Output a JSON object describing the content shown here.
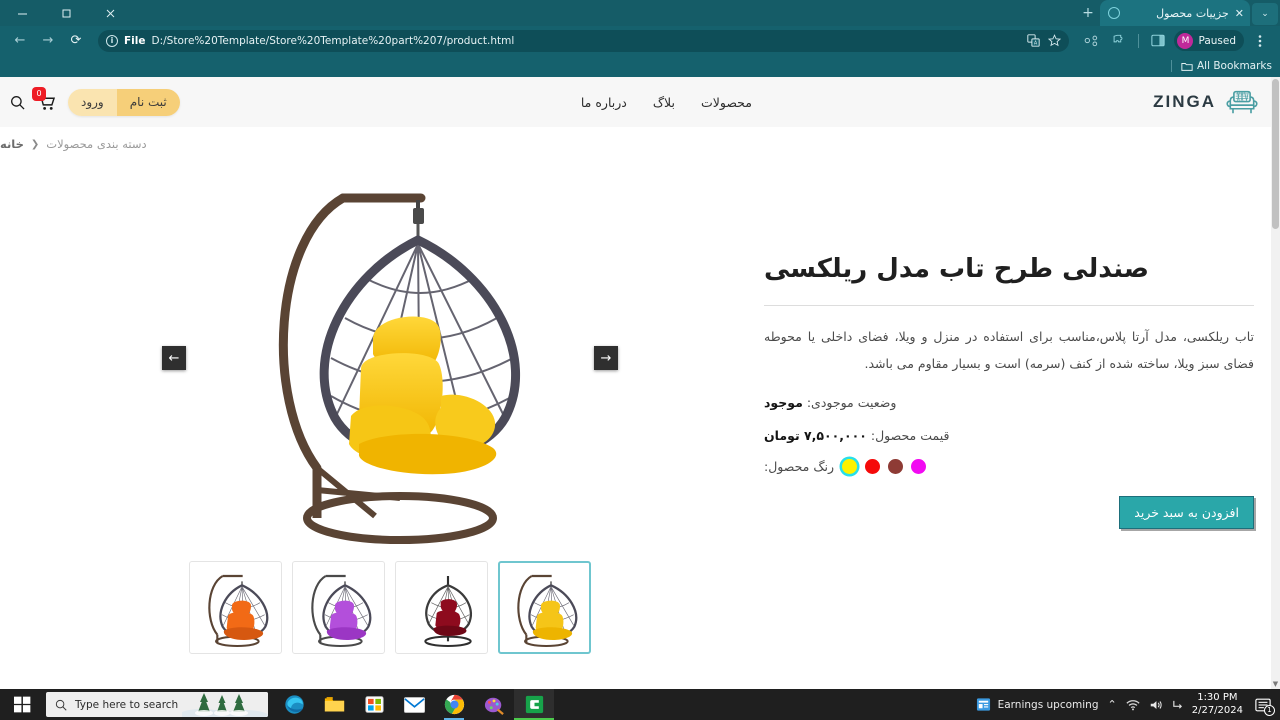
{
  "browser": {
    "tab": {
      "title": "جزییات محصول",
      "favicon": "circle-icon",
      "close": "✕"
    },
    "new_tab_label": "+",
    "tab_list_label": "⌄",
    "window_controls": {
      "minimize": "—",
      "maximize": "❐",
      "close": "✕"
    },
    "toolbar": {
      "back": "←",
      "forward": "→",
      "reload": "⟳",
      "file_label": "File",
      "url": "D:/Store%20Template/Store%20Template%20part%207/product.html",
      "translate_icon": "translate-icon",
      "bookmark_icon": "star-icon",
      "share_icon": "share-icon",
      "extensions_icon": "puzzle-icon",
      "sidepanel_icon": "side-panel-icon",
      "menu_icon": "kebab-menu-icon",
      "profile": {
        "initial": "M",
        "label": "Paused"
      }
    },
    "bookmarks_bar": {
      "label": "All Bookmarks",
      "icon": "folder-icon"
    }
  },
  "site": {
    "brand": {
      "name": "ZINGA",
      "logo": "armchair-icon",
      "color": "#4a9ea3"
    },
    "nav": [
      {
        "label": "محصولات",
        "name": "nav-products"
      },
      {
        "label": "بلاگ",
        "name": "nav-blog"
      },
      {
        "label": "درباره ما",
        "name": "nav-about"
      }
    ],
    "auth": {
      "signup": "ثبت نام",
      "login": "ورود"
    },
    "cart": {
      "count": "0",
      "icon": "cart-icon"
    },
    "search": {
      "icon": "search-icon"
    }
  },
  "breadcrumb": {
    "home": "خانه",
    "separator": "❮",
    "current": "دسته بندی محصولات"
  },
  "product": {
    "title": "صندلی طرح تاب مدل ریلکسی",
    "description": "تاب ریلکسی، مدل آرتا پلاس،مناسب برای استفاده در منزل و ویلا، فضای داخلی یا محوطه فضای سبز ویلا، ساخته شده از کنف (سرمه) است و بسیار مقاوم می باشد.",
    "availability_label": "وضعیت موجودی:",
    "availability_value": "موجود",
    "price_label": "قیمت محصول:",
    "price_value": "۷,۵۰۰,۰۰۰ تومان",
    "color_label": "رنگ محصول:",
    "colors": [
      {
        "name": "swatch-magenta",
        "hex": "#f20af2",
        "selected": false
      },
      {
        "name": "swatch-brown",
        "hex": "#8e3b35",
        "selected": false
      },
      {
        "name": "swatch-red",
        "hex": "#f50a0a",
        "selected": false
      },
      {
        "name": "swatch-yellow",
        "hex": "#fdf200",
        "selected": true
      }
    ],
    "add_to_cart": "افزودن به سبد خرید",
    "gallery": {
      "prev_label": "←",
      "next_label": "→",
      "thumbs": [
        {
          "name": "thumb-yellow",
          "cushion": "#f5c518",
          "selected": true
        },
        {
          "name": "thumb-darkred",
          "cushion": "#8e0b1e",
          "selected": false
        },
        {
          "name": "thumb-purple",
          "cushion": "#b34fdb",
          "selected": false
        },
        {
          "name": "thumb-orange",
          "cushion": "#f26a16",
          "selected": false
        }
      ],
      "main_cushion": "#f5c518"
    }
  },
  "taskbar": {
    "start": "start-icon",
    "search_placeholder": "Type here to search",
    "apps": [
      {
        "name": "taskbar-edge",
        "label": "Microsoft Edge"
      },
      {
        "name": "taskbar-file-explorer",
        "label": "File Explorer"
      },
      {
        "name": "taskbar-store",
        "label": "Microsoft Store"
      },
      {
        "name": "taskbar-mail",
        "label": "Mail"
      },
      {
        "name": "taskbar-chrome",
        "label": "Google Chrome"
      },
      {
        "name": "taskbar-paint",
        "label": "Paint 3D"
      },
      {
        "name": "taskbar-active-app",
        "label": "Active App"
      }
    ],
    "tray": {
      "news": "Earnings upcoming",
      "chevron": "⌃",
      "network": "network-icon",
      "volume": "volume-icon",
      "keyboard": "ime-icon",
      "time": "1:30 PM",
      "date": "2/27/2024",
      "notification_count": "1"
    }
  }
}
